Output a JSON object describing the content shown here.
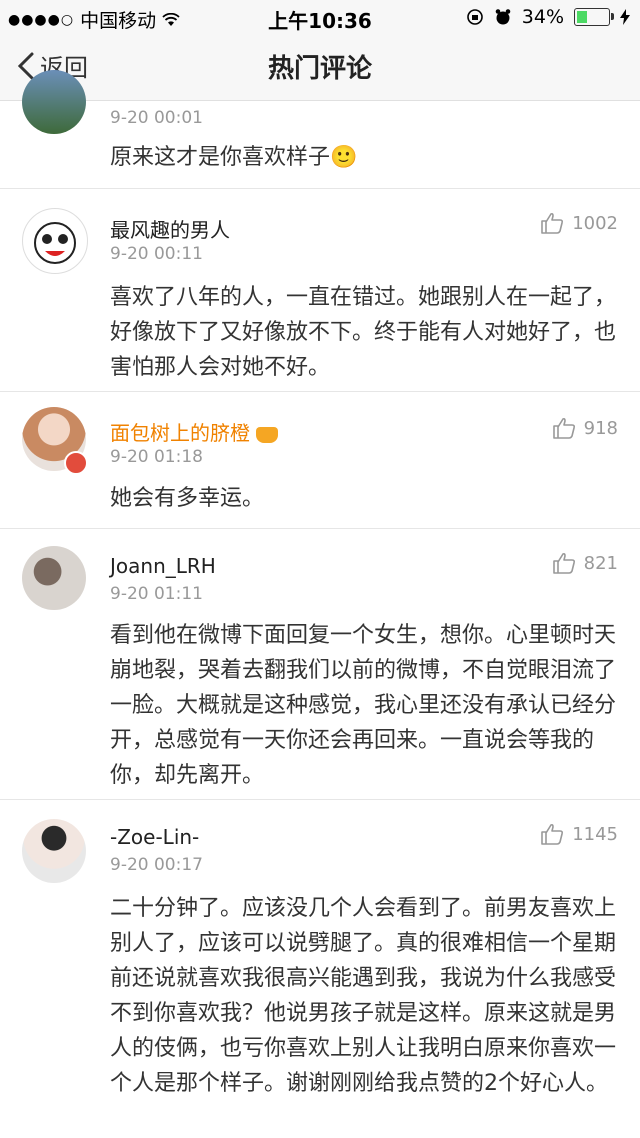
{
  "status": {
    "signal_dots": "●●●●○",
    "carrier": "中国移动",
    "time": "上午10:36",
    "battery": "34%",
    "battery_level": 0.34
  },
  "nav": {
    "back_label": "返回",
    "title": "热门评论"
  },
  "comments": [
    {
      "name": "",
      "time": "9-20 00:01",
      "likes": "",
      "text": "原来这才是你喜欢样子🙂"
    },
    {
      "name": "最风趣的男人",
      "time": "9-20 00:11",
      "likes": "1002",
      "text": "喜欢了八年的人，一直在错过。她跟别人在一起了，好像放下了又好像放不下。终于能有人对她好了，也害怕那人会对她不好。"
    },
    {
      "name": "面包树上的脐橙",
      "time": "9-20 01:18",
      "likes": "918",
      "text": "她会有多幸运。"
    },
    {
      "name": "Joann_LRH",
      "time": "9-20 01:11",
      "likes": "821",
      "text": "看到他在微博下面回复一个女生，想你。心里顿时天崩地裂，哭着去翻我们以前的微博，不自觉眼泪流了一脸。大概就是这种感觉，我心里还没有承认已经分开，总感觉有一天你还会再回来。一直说会等我的你，却先离开。"
    },
    {
      "name": "-Zoe-Lin-",
      "time": "9-20 00:17",
      "likes": "1145",
      "text": "二十分钟了。应该没几个人会看到了。前男友喜欢上别人了，应该可以说劈腿了。真的很难相信一个星期前还说就喜欢我很高兴能遇到我，我说为什么我感受不到你喜欢我？他说男孩子就是这样。原来这就是男人的伎俩，也亏你喜欢上别人让我明白原来你喜欢一个人是那个样子。谢谢刚刚给我点赞的2个好心人。"
    }
  ]
}
